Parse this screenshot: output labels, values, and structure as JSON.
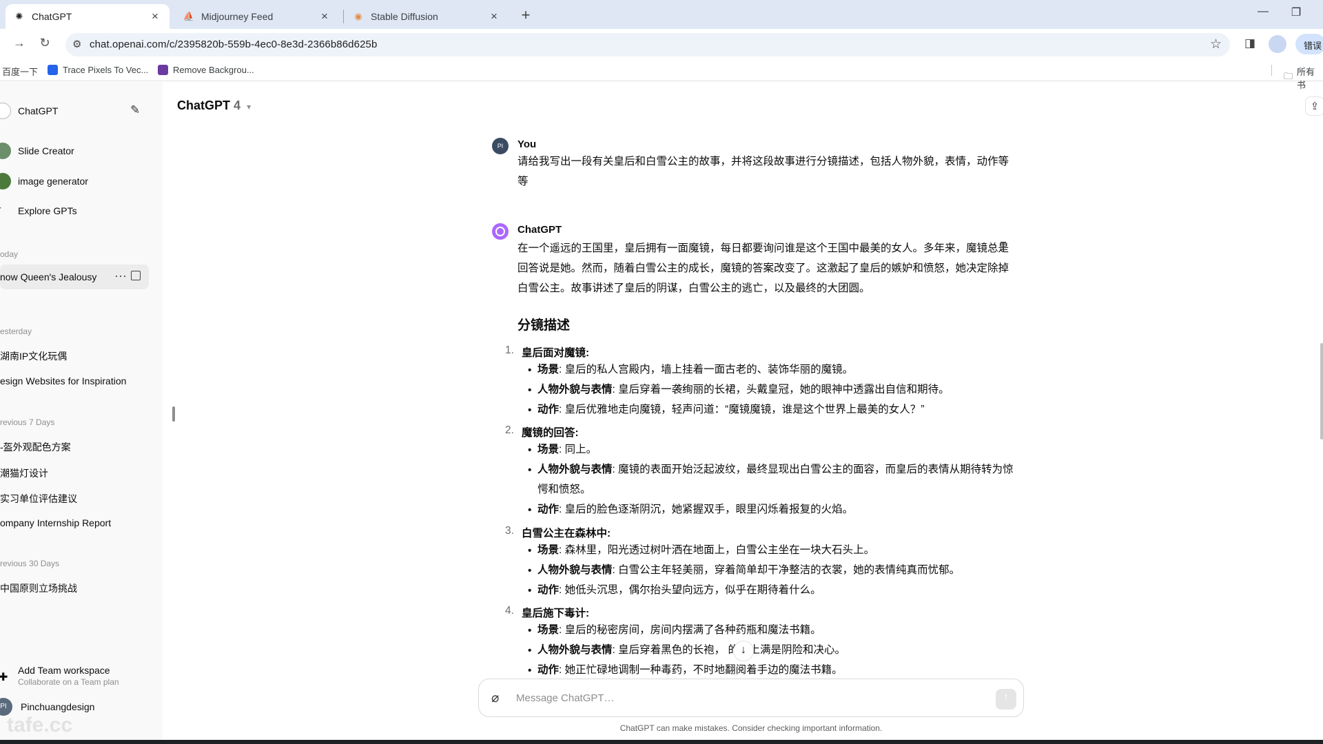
{
  "browser": {
    "tabs": [
      {
        "title": "ChatGPT",
        "active": true
      },
      {
        "title": "Midjourney Feed",
        "active": false
      },
      {
        "title": "Stable Diffusion",
        "active": false
      }
    ],
    "url": "chat.openai.com/c/2395820b-559b-4ec0-8e3d-2366b86d625b",
    "translate_label": "错误",
    "bookmarks": [
      "百度一下",
      "Trace Pixels To Vec...",
      "Remove Backgrou..."
    ],
    "bookmarks_right": "所有书"
  },
  "sidebar": {
    "top": {
      "label": "ChatGPT"
    },
    "gpts": [
      {
        "label": "Slide Creator"
      },
      {
        "label": "image generator"
      },
      {
        "label": "Explore GPTs"
      }
    ],
    "groups": [
      {
        "heading": "oday",
        "chats": [
          "now Queen's Jealousy"
        ]
      },
      {
        "heading": "esterday",
        "chats": [
          "湖南IP文化玩偶",
          "esign Websites for Inspiration"
        ]
      },
      {
        "heading": "revious 7 Days",
        "chats": [
          "-盔外观配色方案",
          "潮猫灯设计",
          "实习单位评估建议",
          "ompany Internship Report"
        ]
      },
      {
        "heading": "revious 30 Days",
        "chats": [
          "中国原则立场挑战"
        ]
      }
    ],
    "team": {
      "title": "Add Team workspace",
      "subtitle": "Collaborate on a Team plan"
    },
    "user": {
      "name": "Pinchuangdesign",
      "initials": "PI"
    }
  },
  "main": {
    "model": "ChatGPT",
    "model_version": "4",
    "user_msg": {
      "name": "You",
      "initials": "PI",
      "text": "请给我写出一段有关皇后和白雪公主的故事，并将这段故事进行分镜描述，包括人物外貌，表情，动作等等"
    },
    "assistant_msg": {
      "name": "ChatGPT",
      "intro": "在一个遥远的王国里，皇后拥有一面魔镜，每日都要询问谁是这个王国中最美的女人。多年来，魔镜总是回答说是她。然而，随着白雪公主的成长，魔镜的答案改变了。这激起了皇后的嫉妒和愤怒，她决定除掉白雪公主。故事讲述了皇后的阴谋，白雪公主的逃亡，以及最终的大团圆。",
      "heading": "分镜描述",
      "sections": [
        {
          "num": "1.",
          "title": "皇后面对魔镜",
          "bullets": [
            {
              "label": "场景",
              "text": "皇后的私人宫殿内，墙上挂着一面古老的、装饰华丽的魔镜。"
            },
            {
              "label": "人物外貌与表情",
              "text": "皇后穿着一袭绚丽的长裙，头戴皇冠，她的眼神中透露出自信和期待。"
            },
            {
              "label": "动作",
              "text": "皇后优雅地走向魔镜，轻声问道：“魔镜魔镜，谁是这个世界上最美的女人？”"
            }
          ]
        },
        {
          "num": "2.",
          "title": "魔镜的回答",
          "bullets": [
            {
              "label": "场景",
              "text": "同上。"
            },
            {
              "label": "人物外貌与表情",
              "text": "魔镜的表面开始泛起波纹，最终显现出白雪公主的面容，而皇后的表情从期待转为惊愕和愤怒。"
            },
            {
              "label": "动作",
              "text": "皇后的脸色逐渐阴沉，她紧握双手，眼里闪烁着报复的火焰。"
            }
          ]
        },
        {
          "num": "3.",
          "title": "白雪公主在森林中",
          "bullets": [
            {
              "label": "场景",
              "text": "森林里，阳光透过树叶洒在地面上，白雪公主坐在一块大石头上。"
            },
            {
              "label": "人物外貌与表情",
              "text": "白雪公主年轻美丽，穿着简单却干净整洁的衣裳，她的表情纯真而忧郁。"
            },
            {
              "label": "动作",
              "text": "她低头沉思，偶尔抬头望向远方，似乎在期待着什么。"
            }
          ]
        },
        {
          "num": "4.",
          "title": "皇后施下毒计",
          "bullets": [
            {
              "label": "场景",
              "text": "皇后的秘密房间，房间内摆满了各种药瓶和魔法书籍。"
            },
            {
              "label": "人物外貌与表情",
              "text": "皇后穿着黑色的长袍，   的脸上满是阴险和决心。"
            },
            {
              "label": "动作",
              "text": "她正忙碌地调制一种毒药，不时地翻阅着手边的魔法书籍。"
            }
          ]
        }
      ]
    },
    "composer_placeholder": "Message ChatGPT…",
    "disclaimer": "ChatGPT can make mistakes. Consider checking important information."
  },
  "watermark": "tafe.cc",
  "colors": {
    "accent_purple": "#ab68ff",
    "tabbar": "#dfe7f5",
    "sidebar_bg": "#f9f9f9"
  }
}
